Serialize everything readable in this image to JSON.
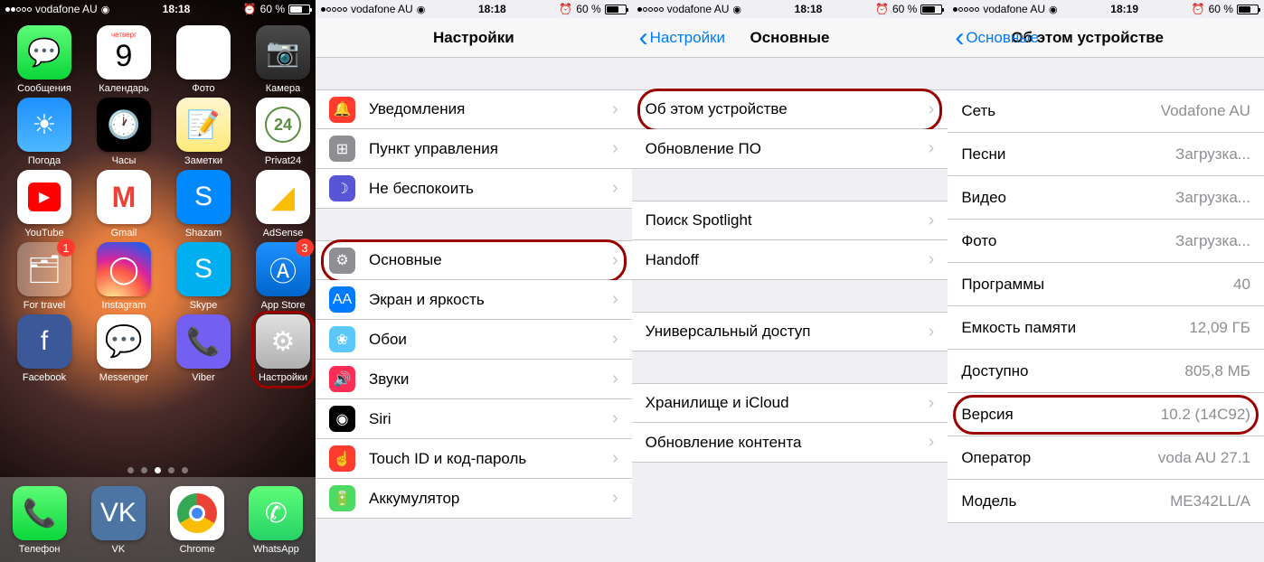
{
  "statusbar": {
    "carrier": "vodafone AU",
    "time1": "18:18",
    "time2": "18:19",
    "battery": "60 %",
    "alarm": "⏰"
  },
  "home": {
    "apps": [
      {
        "label": "Сообщения",
        "cls": "hi-messages",
        "glyph": "💬"
      },
      {
        "label": "Календарь",
        "cls": "hi-calendar",
        "glyph": "9",
        "sub": "четверг"
      },
      {
        "label": "Фото",
        "cls": "hi-photos",
        "glyph": "✿"
      },
      {
        "label": "Камера",
        "cls": "hi-camera",
        "glyph": "📷"
      },
      {
        "label": "Погода",
        "cls": "hi-weather",
        "glyph": "☀"
      },
      {
        "label": "Часы",
        "cls": "hi-clock",
        "glyph": "🕐"
      },
      {
        "label": "Заметки",
        "cls": "hi-notes",
        "glyph": "📝"
      },
      {
        "label": "Privat24",
        "cls": "hi-privat",
        "glyph": "24"
      },
      {
        "label": "YouTube",
        "cls": "hi-youtube",
        "glyph": "▶"
      },
      {
        "label": "Gmail",
        "cls": "hi-gmail",
        "glyph": "M"
      },
      {
        "label": "Shazam",
        "cls": "hi-shazam",
        "glyph": "S"
      },
      {
        "label": "AdSense",
        "cls": "hi-adsense",
        "glyph": "◢"
      },
      {
        "label": "For travel",
        "cls": "hi-folder",
        "glyph": "🗂",
        "badge": "1"
      },
      {
        "label": "Instagram",
        "cls": "hi-instagram",
        "glyph": "◯"
      },
      {
        "label": "Skype",
        "cls": "hi-skype",
        "glyph": "S"
      },
      {
        "label": "App Store",
        "cls": "hi-appstore",
        "glyph": "Ⓐ",
        "badge": "3"
      },
      {
        "label": "Facebook",
        "cls": "hi-facebook",
        "glyph": "f"
      },
      {
        "label": "Messenger",
        "cls": "hi-messenger",
        "glyph": "⚡"
      },
      {
        "label": "Viber",
        "cls": "hi-viber",
        "glyph": "📞"
      },
      {
        "label": "Настройки",
        "cls": "hi-settings",
        "glyph": "⚙",
        "highlight": true
      }
    ],
    "dock": [
      {
        "label": "Телефон",
        "cls": "hi-phone",
        "glyph": "📞"
      },
      {
        "label": "VK",
        "cls": "hi-vk",
        "glyph": "VK"
      },
      {
        "label": "Chrome",
        "cls": "hi-chrome",
        "glyph": "◉"
      },
      {
        "label": "WhatsApp",
        "cls": "hi-whatsapp",
        "glyph": "✆"
      }
    ]
  },
  "settings": {
    "title": "Настройки",
    "items": [
      {
        "label": "Уведомления",
        "cls": "c-red",
        "glyph": "🔔"
      },
      {
        "label": "Пункт управления",
        "cls": "c-gray",
        "glyph": "⊞"
      },
      {
        "label": "Не беспокоить",
        "cls": "c-purple",
        "glyph": "☽"
      },
      {
        "label": "Основные",
        "cls": "c-gray",
        "glyph": "⚙",
        "gap": true,
        "highlight": true
      },
      {
        "label": "Экран и яркость",
        "cls": "c-blue",
        "glyph": "AA"
      },
      {
        "label": "Обои",
        "cls": "c-teal",
        "glyph": "❀"
      },
      {
        "label": "Звуки",
        "cls": "c-pink",
        "glyph": "🔊"
      },
      {
        "label": "Siri",
        "cls": "c-black",
        "glyph": "◉"
      },
      {
        "label": "Touch ID и код-пароль",
        "cls": "c-red",
        "glyph": "☝"
      },
      {
        "label": "Аккумулятор",
        "cls": "c-green",
        "glyph": "🔋"
      }
    ]
  },
  "general": {
    "back": "Настройки",
    "title": "Основные",
    "items": [
      {
        "label": "Об этом устройстве",
        "highlight": true
      },
      {
        "label": "Обновление ПО"
      },
      {
        "label": "Поиск Spotlight",
        "gap": true
      },
      {
        "label": "Handoff"
      },
      {
        "label": "Универсальный доступ",
        "gap": true
      },
      {
        "label": "Хранилище и iCloud",
        "gap": true
      },
      {
        "label": "Обновление контента"
      }
    ]
  },
  "about": {
    "back": "Основные",
    "title": "Об этом устройстве",
    "items": [
      {
        "label": "Сеть",
        "value": "Vodafone AU"
      },
      {
        "label": "Песни",
        "value": "Загрузка..."
      },
      {
        "label": "Видео",
        "value": "Загрузка..."
      },
      {
        "label": "Фото",
        "value": "Загрузка..."
      },
      {
        "label": "Программы",
        "value": "40"
      },
      {
        "label": "Емкость памяти",
        "value": "12,09 ГБ"
      },
      {
        "label": "Доступно",
        "value": "805,8 МБ"
      },
      {
        "label": "Версия",
        "value": "10.2 (14C92)",
        "highlight": true
      },
      {
        "label": "Оператор",
        "value": "voda AU 27.1"
      },
      {
        "label": "Модель",
        "value": "ME342LL/A"
      }
    ]
  }
}
